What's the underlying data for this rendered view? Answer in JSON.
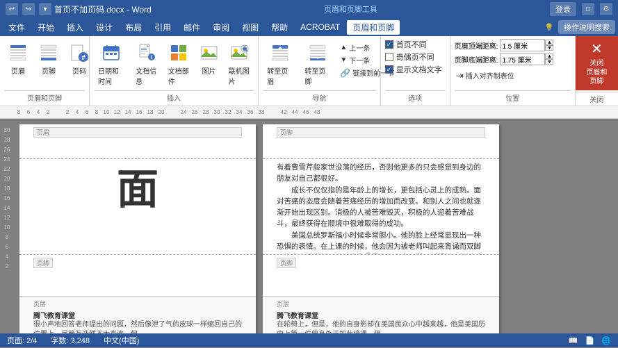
{
  "titlebar": {
    "filename": "首页不加页码.docx - Word",
    "app_section": "页眉和页脚工具",
    "signin": "登录",
    "controls": [
      "—",
      "□",
      "✕"
    ]
  },
  "menubar": {
    "items": [
      {
        "label": "文件",
        "id": "file"
      },
      {
        "label": "开始",
        "id": "home"
      },
      {
        "label": "插入",
        "id": "insert"
      },
      {
        "label": "设计",
        "id": "design"
      },
      {
        "label": "布局",
        "id": "layout"
      },
      {
        "label": "引用",
        "id": "references"
      },
      {
        "label": "邮件",
        "id": "mail"
      },
      {
        "label": "审阅",
        "id": "review"
      },
      {
        "label": "视图",
        "id": "view"
      },
      {
        "label": "帮助",
        "id": "help"
      },
      {
        "label": "ACROBAT",
        "id": "acrobat"
      },
      {
        "label": "页眉和页脚",
        "id": "header-footer",
        "active": true
      }
    ],
    "right": {
      "search_placeholder": "操作说明搜索"
    }
  },
  "ribbon": {
    "sections": [
      {
        "id": "header-footer-section",
        "title": "页眉和页脚",
        "buttons": [
          {
            "label": "页眉",
            "icon": "☰",
            "id": "header-btn"
          },
          {
            "label": "页脚",
            "icon": "☰",
            "id": "footer-btn"
          },
          {
            "label": "页码",
            "icon": "#",
            "id": "page-num-btn"
          }
        ]
      },
      {
        "id": "insert-section",
        "title": "插入",
        "buttons": [
          {
            "label": "日期和时间",
            "icon": "📅",
            "id": "datetime-btn"
          },
          {
            "label": "文档信息",
            "icon": "📄",
            "id": "doc-info-btn"
          },
          {
            "label": "文档部件",
            "icon": "📦",
            "id": "doc-parts-btn"
          },
          {
            "label": "图片",
            "icon": "🖼",
            "id": "picture-btn"
          },
          {
            "label": "联机图片",
            "icon": "🔍",
            "id": "online-pic-btn"
          }
        ]
      },
      {
        "id": "nav-section",
        "title": "导航",
        "buttons": [
          {
            "label": "转至页眉",
            "icon": "↑",
            "id": "goto-header-btn"
          },
          {
            "label": "转至页脚",
            "icon": "↓",
            "id": "goto-footer-btn"
          },
          {
            "label": "上一条",
            "icon": "▲",
            "id": "prev-btn"
          },
          {
            "label": "下一条",
            "icon": "▼",
            "id": "next-btn"
          },
          {
            "label": "链接到前一节",
            "icon": "🔗",
            "id": "link-prev-btn"
          }
        ]
      },
      {
        "id": "options-section",
        "title": "选项",
        "options": [
          {
            "label": "首页不同",
            "checked": true,
            "id": "first-diff"
          },
          {
            "label": "奇偶页不同",
            "checked": false,
            "id": "odd-even-diff"
          },
          {
            "label": "显示文档文字",
            "checked": true,
            "id": "show-doc-text"
          }
        ]
      },
      {
        "id": "position-section",
        "title": "位置",
        "fields": [
          {
            "label": "页眉顶端距离:",
            "value": "1.5 厘米",
            "id": "header-top"
          },
          {
            "label": "页脚底端距离:",
            "value": "1.75 厘米",
            "id": "footer-bottom"
          },
          {
            "label": "插入对齐制表位",
            "id": "insert-tab"
          }
        ]
      },
      {
        "id": "close-section",
        "title": "关闭",
        "button": {
          "label": "关闭\n页眉和页脚",
          "id": "close-hf-btn"
        }
      }
    ]
  },
  "ruler": {
    "marks": [
      "8",
      "6",
      "4",
      "2",
      "",
      "2",
      "4",
      "6",
      "8",
      "10",
      "12",
      "14",
      "16",
      "18",
      "20",
      "",
      "24",
      "26",
      "28",
      "30",
      "32",
      "34",
      "36",
      "38",
      "",
      "42",
      "44",
      "46",
      "48"
    ]
  },
  "pages": [
    {
      "id": "page1",
      "header_label": "页眉",
      "big_char": "面",
      "content": "",
      "footer_label": "页脚",
      "footer_content": "",
      "sub_label": "页层",
      "sub_content": "腾飞教育课堂\n很小声地回答老师提出的问题，然后像泄了气的皮球一样缩回自己的位置上。尽管互选然不太喜欢，但"
    },
    {
      "id": "page2",
      "header_label": "页脚",
      "content": "有着曹雪芹般家世没落的经历，否则他更多的只会感觉到身边的朋友对自己都很好。\n　　成长不仅仅指的是年龄上的增长，更包括心灵上的成熟。面对苦痛的态度会随着苦痛经历的增加而改变。和别人之间也就逐渐开始出现区别。消极的人被苦难毁灭，积极的人迎着苦难战斗，最终获得在顺境中很难取得的成功。\n　　美国总统罗斯福小时候非常胆小。他的脸上经常显现出一种恐惧的表情。在上课的时候，他会因为被老师叫起来背诵而双脚不由自主地发抖，嘴唇也像暴露在严寒中一样不断颤抖。他说话非常含糊，因为他很懦弱，连大声地把话说清楚的勇气都很缺乏。他会",
      "footer_label": "页脚",
      "footer_content": "",
      "cursor": true,
      "sub_label": "页层",
      "sub_content": "腾飞教育课堂\n在轮椅上，但是，他的自身影却在美国民众心中越来越，他是美国历史上第一位曾身处于如此境遇，但"
    }
  ],
  "statusbar": {
    "page_info": "页面: 2/4",
    "word_count": "字数: 3,248",
    "lang": "中文(中国)",
    "view": "阅读",
    "layout": "页面布局"
  }
}
